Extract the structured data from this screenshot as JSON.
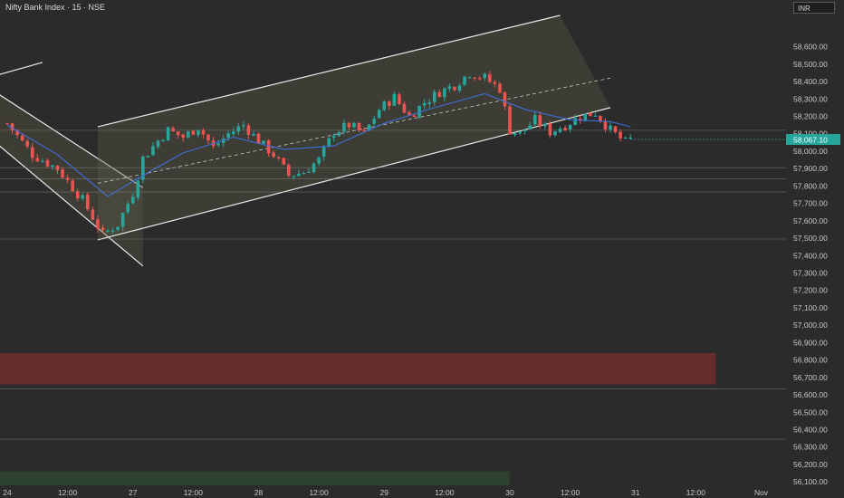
{
  "header": {
    "title": "Nifty Bank Index · 15 · NSE",
    "currency": "INR"
  },
  "colors": {
    "background": "#2b2b2b",
    "bullish": "#26a69a",
    "bearish": "#ef5350",
    "channel": "#e8e8e8",
    "ma": "#3f6fd8",
    "supply_zone": "#7a2e30",
    "demand_zone": "#2e4a34",
    "price_tag": "#26a69a"
  },
  "chart_data": {
    "type": "candlestick",
    "title": "Nifty Bank Index · 15 · NSE",
    "y_axis": {
      "range": [
        56080,
        58780
      ],
      "ticks": [
        58600,
        58500,
        58400,
        58300,
        58200,
        58100,
        58000,
        57900,
        57800,
        57700,
        57600,
        57500,
        57400,
        57300,
        57200,
        57100,
        57000,
        56900,
        56800,
        56700,
        56600,
        56500,
        56400,
        56300,
        56200,
        56100
      ],
      "tick_labels": [
        "58,600.00",
        "58,500.00",
        "58,400.00",
        "58,300.00",
        "58,200.00",
        "58,100.00",
        "58,000.00",
        "57,900.00",
        "57,800.00",
        "57,700.00",
        "57,600.00",
        "57,500.00",
        "57,400.00",
        "57,300.00",
        "57,200.00",
        "57,100.00",
        "57,000.00",
        "56,900.00",
        "56,800.00",
        "56,700.00",
        "56,600.00",
        "56,500.00",
        "56,400.00",
        "56,300.00",
        "56,200.00",
        "56,100.00"
      ]
    },
    "x_axis": {
      "ticks": [
        {
          "label": "24",
          "bar": 0
        },
        {
          "label": "12:00",
          "bar": 12
        },
        {
          "label": "27",
          "bar": 25
        },
        {
          "label": "12:00",
          "bar": 37
        },
        {
          "label": "28",
          "bar": 50
        },
        {
          "label": "12:00",
          "bar": 62
        },
        {
          "label": "29",
          "bar": 75
        },
        {
          "label": "12:00",
          "bar": 87
        },
        {
          "label": "30",
          "bar": 100
        },
        {
          "label": "12:00",
          "bar": 112
        },
        {
          "label": "31",
          "bar": 125
        },
        {
          "label": "12:00",
          "bar": 137
        },
        {
          "label": "Nov",
          "bar": 150
        }
      ]
    },
    "last_price": {
      "value": 58067.1,
      "label": "58,067.10"
    },
    "close_path": [
      [
        0,
        58160
      ],
      [
        5,
        57980
      ],
      [
        10,
        57900
      ],
      [
        15,
        57720
      ],
      [
        19,
        57520
      ],
      [
        22,
        57580
      ],
      [
        25,
        57760
      ],
      [
        27,
        57960
      ],
      [
        30,
        58060
      ],
      [
        32,
        58120
      ],
      [
        35,
        58080
      ],
      [
        38,
        58140
      ],
      [
        41,
        58020
      ],
      [
        44,
        58100
      ],
      [
        47,
        58150
      ],
      [
        50,
        58060
      ],
      [
        53,
        57980
      ],
      [
        56,
        57860
      ],
      [
        59,
        57880
      ],
      [
        62,
        57950
      ],
      [
        65,
        58110
      ],
      [
        68,
        58150
      ],
      [
        71,
        58100
      ],
      [
        74,
        58240
      ],
      [
        77,
        58310
      ],
      [
        80,
        58200
      ],
      [
        83,
        58280
      ],
      [
        86,
        58340
      ],
      [
        89,
        58380
      ],
      [
        92,
        58450
      ],
      [
        95,
        58420
      ],
      [
        98,
        58360
      ],
      [
        100,
        58120
      ],
      [
        102,
        58100
      ],
      [
        105,
        58180
      ],
      [
        108,
        58110
      ],
      [
        111,
        58150
      ],
      [
        114,
        58200
      ],
      [
        117,
        58220
      ],
      [
        120,
        58120
      ],
      [
        123,
        58050
      ],
      [
        124,
        58067
      ]
    ],
    "moving_average": [
      [
        0,
        58150
      ],
      [
        10,
        57980
      ],
      [
        20,
        57740
      ],
      [
        27,
        57860
      ],
      [
        35,
        57990
      ],
      [
        45,
        58080
      ],
      [
        55,
        58010
      ],
      [
        65,
        58030
      ],
      [
        75,
        58160
      ],
      [
        85,
        58250
      ],
      [
        95,
        58330
      ],
      [
        103,
        58240
      ],
      [
        112,
        58180
      ],
      [
        120,
        58170
      ],
      [
        124,
        58140
      ]
    ],
    "channels": [
      {
        "upper": [
          [
            -4,
            58420
          ],
          [
            7,
            58510
          ]
        ],
        "lower": []
      },
      {
        "upper": [
          [
            -4,
            58370
          ],
          [
            27,
            57790
          ]
        ],
        "lower": [
          [
            -4,
            58090
          ],
          [
            27,
            57340
          ]
        ]
      },
      {
        "upper": [
          [
            18,
            58140
          ],
          [
            110,
            58780
          ]
        ],
        "lower": [
          [
            18,
            57490
          ],
          [
            120,
            58250
          ]
        ],
        "mid": [
          [
            18,
            57815
          ],
          [
            120,
            58420
          ]
        ]
      }
    ],
    "horizontal_levels": [
      58120,
      57905,
      57840,
      57765,
      57495,
      56635,
      56345
    ],
    "zones": [
      {
        "type": "supply",
        "from_bar": -4,
        "to_bar": 141,
        "low": 56660,
        "high": 56840
      },
      {
        "type": "demand",
        "from_bar": -4,
        "to_bar": 100,
        "low": 56080,
        "high": 56160
      }
    ]
  }
}
